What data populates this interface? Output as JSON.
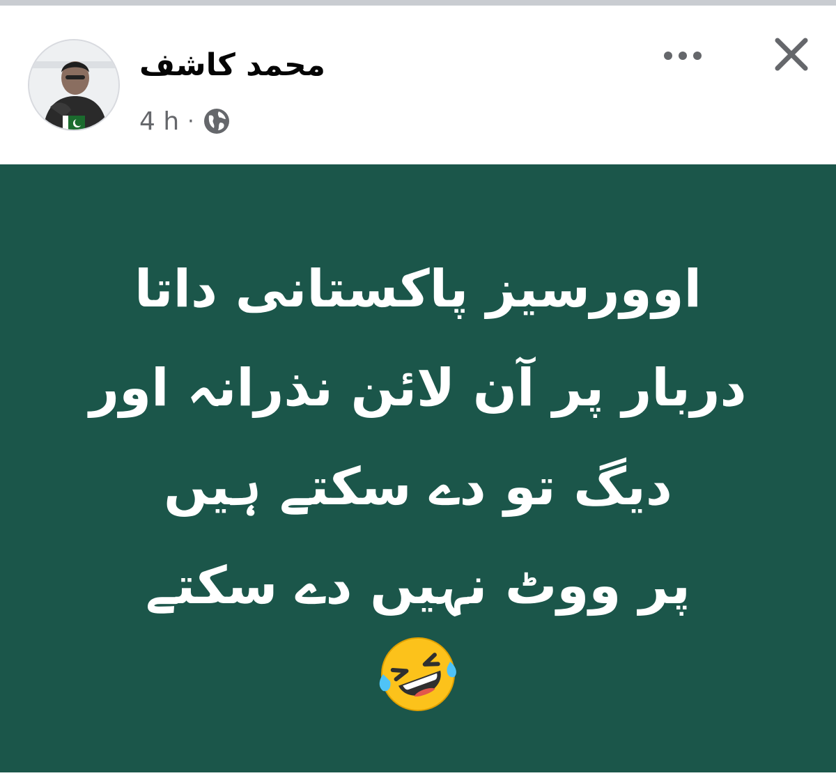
{
  "post": {
    "author": "محمد کاشف",
    "time": "4 h",
    "separator": "·",
    "audience_icon": "globe-icon",
    "more_icon": "more-horizontal-icon",
    "close_icon": "close-icon",
    "avatar_badge": "pakistan-flag",
    "text_lines": [
      "اوورسیز پاکستانی داتا",
      "دربار پر آن لائن نذرانہ اور",
      "دیگ تو دے سکتے ہیں",
      "پر ووٹ نہیں دے سکتے"
    ],
    "emoji": "rolling-on-the-floor-laughing-emoji"
  },
  "colors": {
    "background_green": "#1b564a",
    "text_white": "#ffffff",
    "meta_gray": "#65676b",
    "name_black": "#050505"
  }
}
